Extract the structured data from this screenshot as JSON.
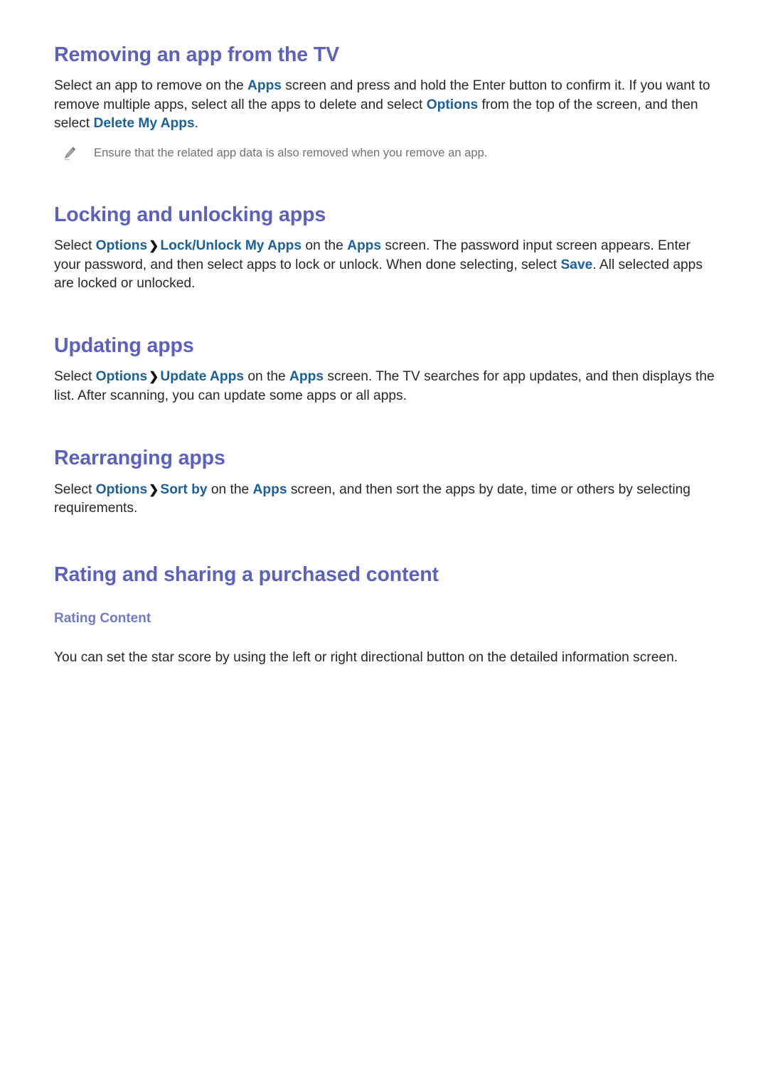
{
  "colors": {
    "heading": "#5b61bf",
    "subheading": "#7379cb",
    "link": "#19609f",
    "body": "#272727",
    "note": "#6e7379",
    "background": "#ffffff"
  },
  "sections": [
    {
      "id": "removing-app",
      "title": "Removing an app from the TV",
      "paragraph": {
        "parts": [
          {
            "type": "text",
            "value": "Select an app to remove on the "
          },
          {
            "type": "em",
            "value": "Apps"
          },
          {
            "type": "text",
            "value": " screen and press and hold the Enter button to confirm it. If you want to remove multiple apps, select all the apps to delete and select "
          },
          {
            "type": "em",
            "value": "Options"
          },
          {
            "type": "text",
            "value": " from the top of the screen, and then select "
          },
          {
            "type": "em",
            "value": "Delete My Apps"
          },
          {
            "type": "text",
            "value": "."
          }
        ]
      },
      "note": {
        "icon": "pencil-icon",
        "text": "Ensure that the related app data is also removed when you remove an app."
      }
    },
    {
      "id": "locking-unlocking",
      "title": "Locking and unlocking apps",
      "paragraph": {
        "parts": [
          {
            "type": "text",
            "value": "Select "
          },
          {
            "type": "em",
            "value": "Options"
          },
          {
            "type": "chevron",
            "value": "❯"
          },
          {
            "type": "em",
            "value": "Lock/Unlock My Apps"
          },
          {
            "type": "text",
            "value": " on the "
          },
          {
            "type": "em",
            "value": "Apps"
          },
          {
            "type": "text",
            "value": " screen. The password input screen appears. Enter your password, and then select apps to lock or unlock. When done selecting, select "
          },
          {
            "type": "em",
            "value": "Save"
          },
          {
            "type": "text",
            "value": ". All selected apps are locked or unlocked."
          }
        ]
      }
    },
    {
      "id": "updating-apps",
      "title": "Updating apps",
      "paragraph": {
        "parts": [
          {
            "type": "text",
            "value": "Select "
          },
          {
            "type": "em",
            "value": "Options"
          },
          {
            "type": "chevron",
            "value": "❯"
          },
          {
            "type": "em",
            "value": "Update Apps"
          },
          {
            "type": "text",
            "value": " on the "
          },
          {
            "type": "em",
            "value": "Apps"
          },
          {
            "type": "text",
            "value": " screen. The TV searches for app updates, and then displays the list. After scanning, you can update some apps or all apps."
          }
        ]
      }
    },
    {
      "id": "rearranging-apps",
      "title": "Rearranging apps",
      "paragraph": {
        "parts": [
          {
            "type": "text",
            "value": "Select "
          },
          {
            "type": "em",
            "value": "Options"
          },
          {
            "type": "chevron",
            "value": "❯"
          },
          {
            "type": "em",
            "value": "Sort by"
          },
          {
            "type": "text",
            "value": " on the "
          },
          {
            "type": "em",
            "value": "Apps"
          },
          {
            "type": "text",
            "value": " screen, and then sort the apps by date, time or others by selecting requirements."
          }
        ]
      }
    },
    {
      "id": "rating-sharing",
      "title": "Rating and sharing a purchased content",
      "subtitle": "Rating Content",
      "paragraph": {
        "parts": [
          {
            "type": "text",
            "value": "You can set the star score by using the left or right directional button on the detailed information screen."
          }
        ]
      }
    }
  ]
}
